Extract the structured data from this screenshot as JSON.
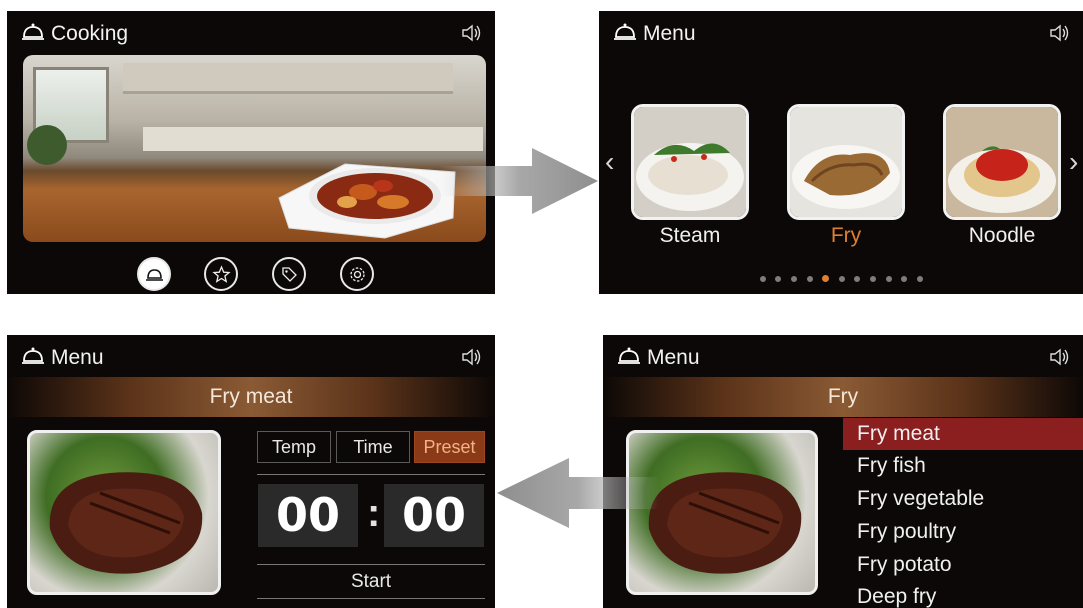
{
  "screens": {
    "cooking": {
      "title": "Cooking",
      "nav_icons": [
        "cloche-icon",
        "star-icon",
        "tag-icon",
        "gear-icon"
      ]
    },
    "menu": {
      "title": "Menu",
      "categories": [
        {
          "label": "Steam",
          "active": false
        },
        {
          "label": "Fry",
          "active": true
        },
        {
          "label": "Noodle",
          "active": false
        }
      ],
      "page_count": 11,
      "active_page": 4
    },
    "fry_list": {
      "title": "Menu",
      "header": "Fry",
      "items": [
        "Fry meat",
        "Fry fish",
        "Fry vegetable",
        "Fry poultry",
        "Fry potato",
        "Deep fry"
      ],
      "selected_item": "Fry meat"
    },
    "fry_meat": {
      "title": "Menu",
      "header": "Fry meat",
      "tabs": [
        "Temp",
        "Time",
        "Preset"
      ],
      "active_tab": "Preset",
      "hours": "00",
      "colon": ":",
      "minutes": "00",
      "start_label": "Start"
    }
  },
  "colors": {
    "accent_orange": "#e07f2f",
    "selected_red": "#8b1e1e",
    "screen_bg": "#0b0807"
  }
}
